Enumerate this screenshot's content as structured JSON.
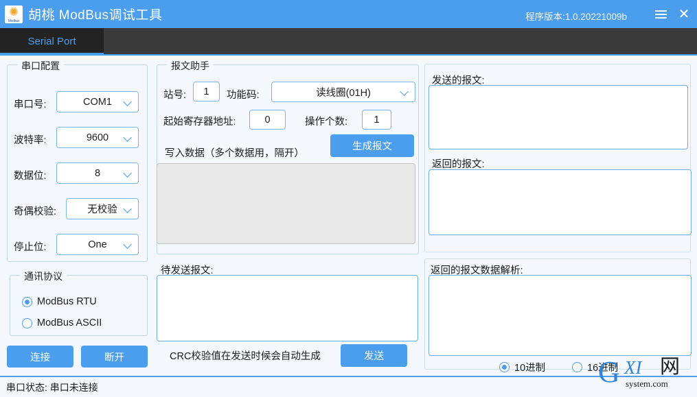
{
  "window": {
    "title": "胡桃 ModBus调试工具",
    "icon_name": "sunflower-modbus-icon",
    "icon_caption": "Modbus",
    "version_text": "程序版本:1.0.20221009b",
    "menu_icon": "hamburger-menu-icon",
    "close_icon": "close-icon",
    "titlebar_color": "#4a9eed"
  },
  "tabs": [
    {
      "label": "Serial Port",
      "active": true
    }
  ],
  "serial_config": {
    "legend": "串口配置",
    "fields": [
      {
        "label": "串口号:",
        "value": "COM1"
      },
      {
        "label": "波特率:",
        "value": "9600"
      },
      {
        "label": "数据位:",
        "value": "8"
      },
      {
        "label": "奇偶校验:",
        "value": "无校验"
      },
      {
        "label": "停止位:",
        "value": "One"
      }
    ]
  },
  "protocol": {
    "legend": "通讯协议",
    "options": [
      {
        "label": "ModBus RTU",
        "selected": true
      },
      {
        "label": "ModBus ASCII",
        "selected": false
      }
    ]
  },
  "actions": {
    "connect_label": "连接",
    "disconnect_label": "断开"
  },
  "message_helper": {
    "legend": "报文助手",
    "station_label": "站号:",
    "station_value": "1",
    "function_code_label": "功能码:",
    "function_code_value": "读线圈(01H)",
    "start_address_label": "起始寄存器地址:",
    "start_address_value": "0",
    "count_label": "操作个数:",
    "count_value": "1",
    "write_data_label": "写入数据（多个数据用，隔开）",
    "write_data_value": "",
    "generate_button": "生成报文"
  },
  "pending_message": {
    "label": "待发送报文:",
    "value": "",
    "crc_note": "CRC校验值在发送时候会自动生成",
    "send_button": "发送"
  },
  "right_panel": {
    "sent_label": "发送的报文:",
    "sent_value": "",
    "received_label": "返回的报文:",
    "received_value": "",
    "parsed_label": "返回的报文数据解析:",
    "parsed_value": "",
    "radix_options": [
      {
        "label": "10进制",
        "selected": true
      },
      {
        "label": "16进制",
        "selected": false
      }
    ]
  },
  "statusbar": {
    "text": "串口状态: 串口未连接"
  },
  "watermark": {
    "g": "G",
    "xi": "XI",
    "wang": "网",
    "sub": "system.com"
  }
}
